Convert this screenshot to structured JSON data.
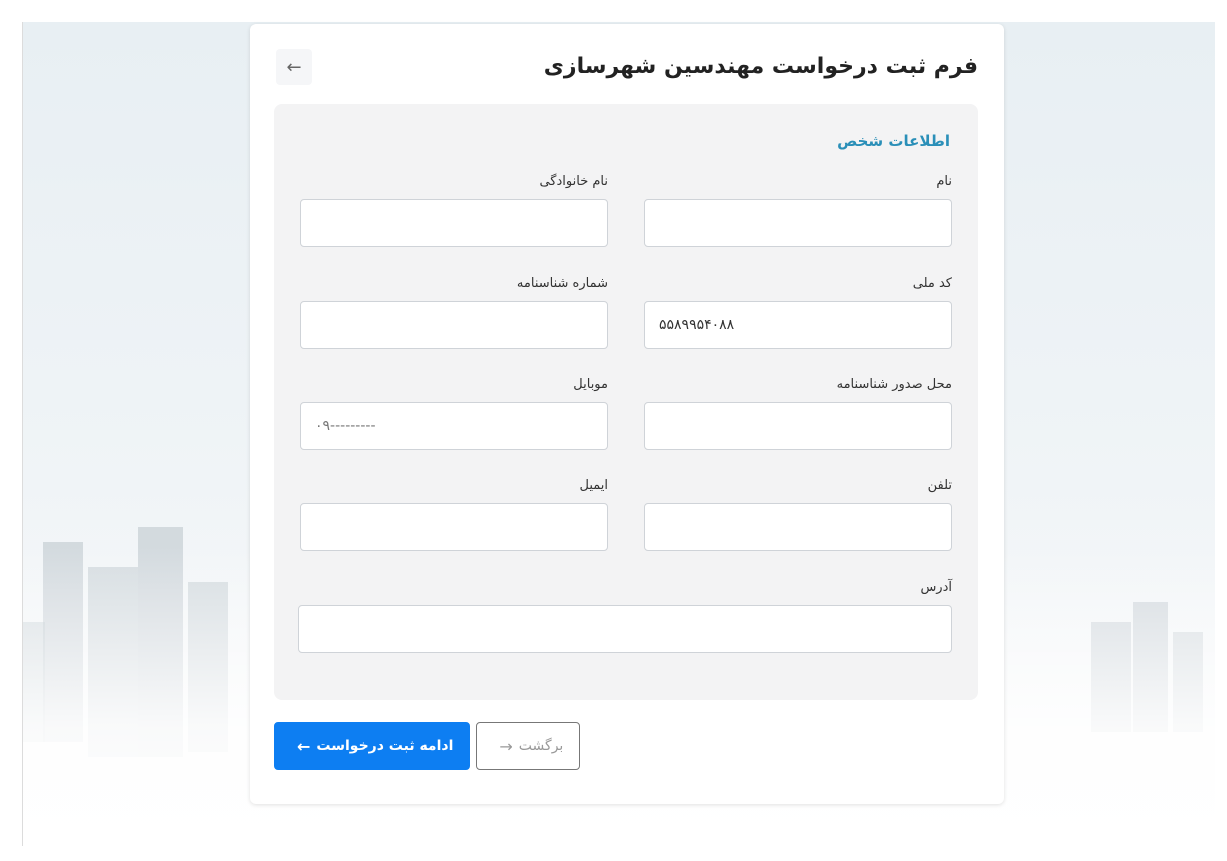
{
  "form": {
    "title": "فرم ثبت درخواست مهندسین شهرسازی",
    "back_icon": "arrow-left-icon",
    "section_title": "اطلاعات شخص",
    "fields": {
      "first_name": {
        "label": "نام",
        "value": ""
      },
      "last_name": {
        "label": "نام خانوادگی",
        "value": ""
      },
      "national_code": {
        "label": "کد ملی",
        "value": "۵۵۸۹۹۵۴۰۸۸"
      },
      "id_number": {
        "label": "شماره شناسنامه",
        "value": ""
      },
      "issue_place": {
        "label": "محل صدور شناسنامه",
        "value": ""
      },
      "mobile": {
        "label": "موبایل",
        "value": "",
        "placeholder": "۰۹---------"
      },
      "phone": {
        "label": "تلفن",
        "value": ""
      },
      "email": {
        "label": "ایمیل",
        "value": ""
      },
      "address": {
        "label": "آدرس",
        "value": ""
      }
    },
    "buttons": {
      "continue": {
        "label": "ادامه ثبت درخواست",
        "icon": "arrow-left-icon"
      },
      "back": {
        "label": "برگشت",
        "icon": "arrow-right-icon"
      }
    }
  },
  "colors": {
    "accent": "#0d7ef2",
    "section_title": "#2a8fb8",
    "panel_bg": "#f3f3f4"
  }
}
